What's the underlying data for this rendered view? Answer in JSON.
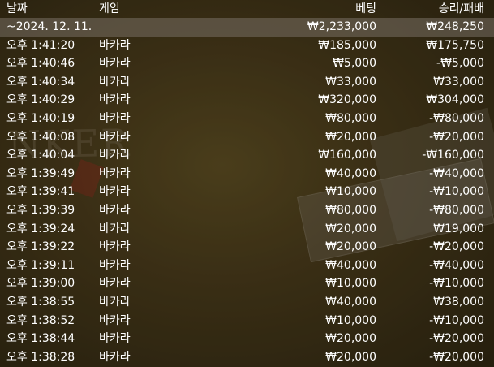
{
  "table": {
    "headers": {
      "date": "날짜",
      "game": "게임",
      "bet": "베팅",
      "result": "승리/패배"
    },
    "summary": {
      "date": "~2024. 12. 11.",
      "bet": "₩2,233,000",
      "result": "₩248,250"
    },
    "rows": [
      {
        "time": "오후 1:41:20",
        "game": "바카라",
        "bet": "₩185,000",
        "result": "₩175,750"
      },
      {
        "time": "오후 1:40:46",
        "game": "바카라",
        "bet": "₩5,000",
        "result": "-₩5,000"
      },
      {
        "time": "오후 1:40:34",
        "game": "바카라",
        "bet": "₩33,000",
        "result": "₩33,000"
      },
      {
        "time": "오후 1:40:29",
        "game": "바카라",
        "bet": "₩320,000",
        "result": "₩304,000"
      },
      {
        "time": "오후 1:40:19",
        "game": "바카라",
        "bet": "₩80,000",
        "result": "-₩80,000"
      },
      {
        "time": "오후 1:40:08",
        "game": "바카라",
        "bet": "₩20,000",
        "result": "-₩20,000"
      },
      {
        "time": "오후 1:40:04",
        "game": "바카라",
        "bet": "₩160,000",
        "result": "-₩160,000"
      },
      {
        "time": "오후 1:39:49",
        "game": "바카라",
        "bet": "₩40,000",
        "result": "-₩40,000"
      },
      {
        "time": "오후 1:39:41",
        "game": "바카라",
        "bet": "₩10,000",
        "result": "-₩10,000"
      },
      {
        "time": "오후 1:39:39",
        "game": "바카라",
        "bet": "₩80,000",
        "result": "-₩80,000"
      },
      {
        "time": "오후 1:39:24",
        "game": "바카라",
        "bet": "₩20,000",
        "result": "₩19,000"
      },
      {
        "time": "오후 1:39:22",
        "game": "바카라",
        "bet": "₩20,000",
        "result": "-₩20,000"
      },
      {
        "time": "오후 1:39:11",
        "game": "바카라",
        "bet": "₩40,000",
        "result": "-₩40,000"
      },
      {
        "time": "오후 1:39:00",
        "game": "바카라",
        "bet": "₩10,000",
        "result": "-₩10,000"
      },
      {
        "time": "오후 1:38:55",
        "game": "바카라",
        "bet": "₩40,000",
        "result": "₩38,000"
      },
      {
        "time": "오후 1:38:52",
        "game": "바카라",
        "bet": "₩10,000",
        "result": "-₩10,000"
      },
      {
        "time": "오후 1:38:44",
        "game": "바카라",
        "bet": "₩20,000",
        "result": "-₩20,000"
      },
      {
        "time": "오후 1:38:28",
        "game": "바카라",
        "bet": "₩20,000",
        "result": "-₩20,000"
      }
    ]
  },
  "background": {
    "watermark_text": "NKER"
  }
}
